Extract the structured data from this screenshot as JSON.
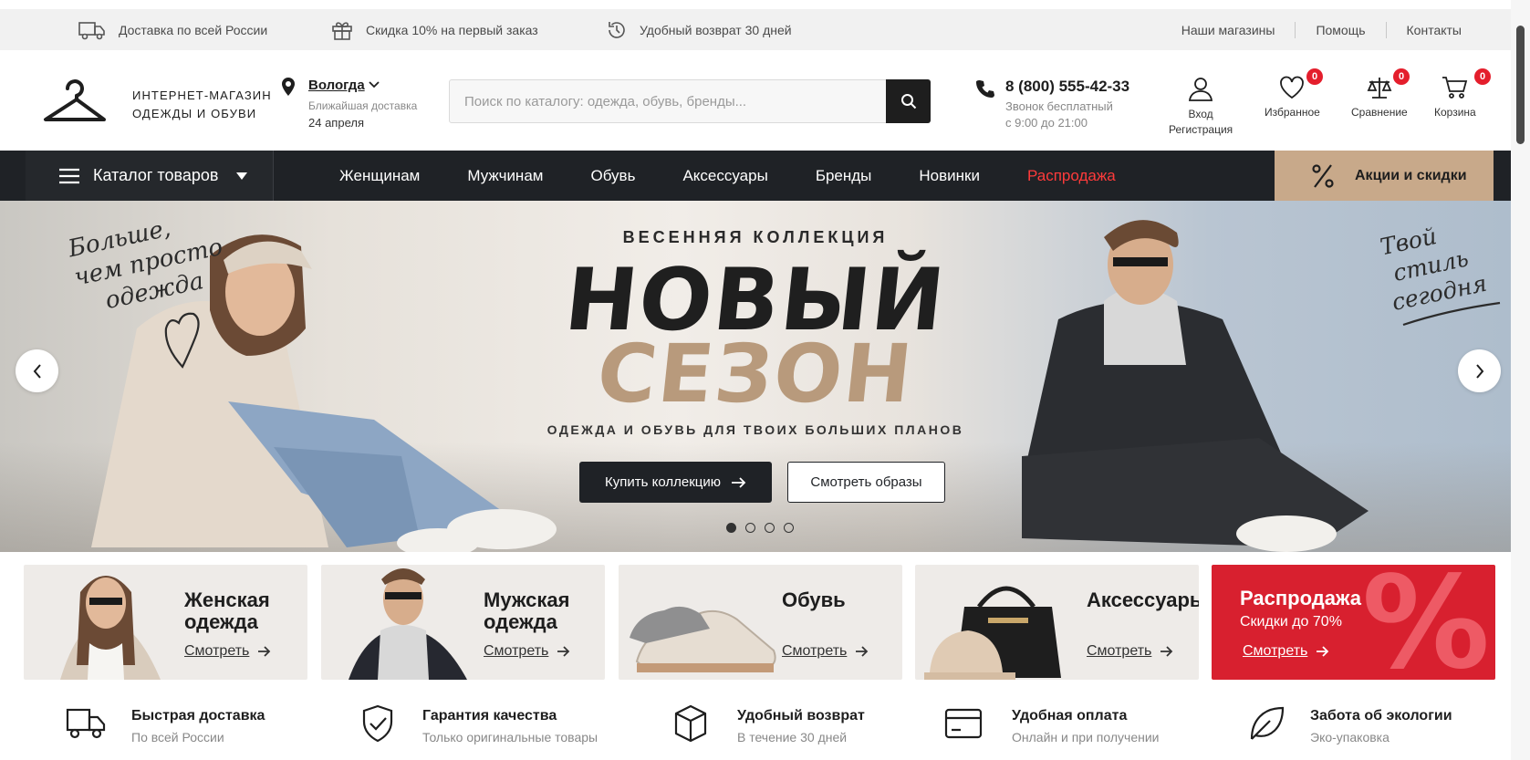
{
  "topbar": {
    "delivery": "Доставка по всей России",
    "discount": "Скидка 10% на первый заказ",
    "returns": "Удобный возврат 30 дней",
    "links": [
      "Наши магазины",
      "Помощь",
      "Контакты"
    ]
  },
  "header": {
    "logo_line1": "ИНТЕРНЕТ-МАГАЗИН",
    "logo_line2": "ОДЕЖДЫ И ОБУВИ",
    "city": "Вологда",
    "city_sub": "Ближайшая доставка",
    "city_date": "24 апреля",
    "search_placeholder": "Поиск по каталогу: одежда, обувь, бренды...",
    "phone": "8 (800) 555-42-33",
    "phone_sub1": "Звонок бесплатный",
    "phone_sub2": "с 9:00 до 21:00",
    "login": "Вход",
    "register": "Регистрация",
    "favorites": "Избранное",
    "favorites_count": "0",
    "compare": "Сравнение",
    "compare_count": "0",
    "cart": "Корзина",
    "cart_count": "0"
  },
  "nav": {
    "catalog": "Каталог товаров",
    "links": [
      "Женщинам",
      "Мужчинам",
      "Обувь",
      "Аксессуары",
      "Бренды",
      "Новинки"
    ],
    "sale": "Распродажа",
    "promo": "Акции и скидки"
  },
  "hero": {
    "script_left": [
      "Больше,",
      "чем просто",
      "одежда"
    ],
    "script_right": [
      "Твой",
      "стиль",
      "сегодня"
    ],
    "kicker": "ВЕСЕННЯЯ КОЛЛЕКЦИЯ",
    "title1": "НОВЫЙ",
    "title2": "СЕЗОН",
    "subtitle": "ОДЕЖДА И ОБУВЬ ДЛЯ ТВОИХ БОЛЬШИХ ПЛАНОВ",
    "btn_primary": "Купить коллекцию",
    "btn_secondary": "Смотреть образы",
    "slides": 4,
    "active_slide": 1
  },
  "categories": [
    {
      "title1": "Женская",
      "title2": "одежда",
      "more": "Смотреть"
    },
    {
      "title1": "Мужская",
      "title2": "одежда",
      "more": "Смотреть"
    },
    {
      "title1": "Обувь",
      "title2": "",
      "more": "Смотреть"
    },
    {
      "title1": "Аксессуары",
      "title2": "",
      "more": "Смотреть"
    },
    {
      "title1": "Распродажа",
      "sub": "Скидки до 70%",
      "more": "Смотреть",
      "symbol": "%"
    }
  ],
  "features": [
    {
      "title": "Быстрая доставка",
      "sub": "По всей России",
      "icon": "truck-icon"
    },
    {
      "title": "Гарантия качества",
      "sub": "Только оригинальные товары",
      "icon": "shield-check-icon"
    },
    {
      "title": "Удобный возврат",
      "sub": "В течение 30 дней",
      "icon": "box-icon"
    },
    {
      "title": "Удобная оплата",
      "sub": "Онлайн и при получении",
      "icon": "card-icon"
    },
    {
      "title": "Забота об экологии",
      "sub": "Эко-упаковка",
      "icon": "leaf-icon"
    }
  ],
  "colors": {
    "dark": "#1f2226",
    "accent_red": "#d8202f",
    "sale_text": "#ff3b3b",
    "promo_beige": "#c8a98a",
    "title_beige": "#b89a7c"
  }
}
